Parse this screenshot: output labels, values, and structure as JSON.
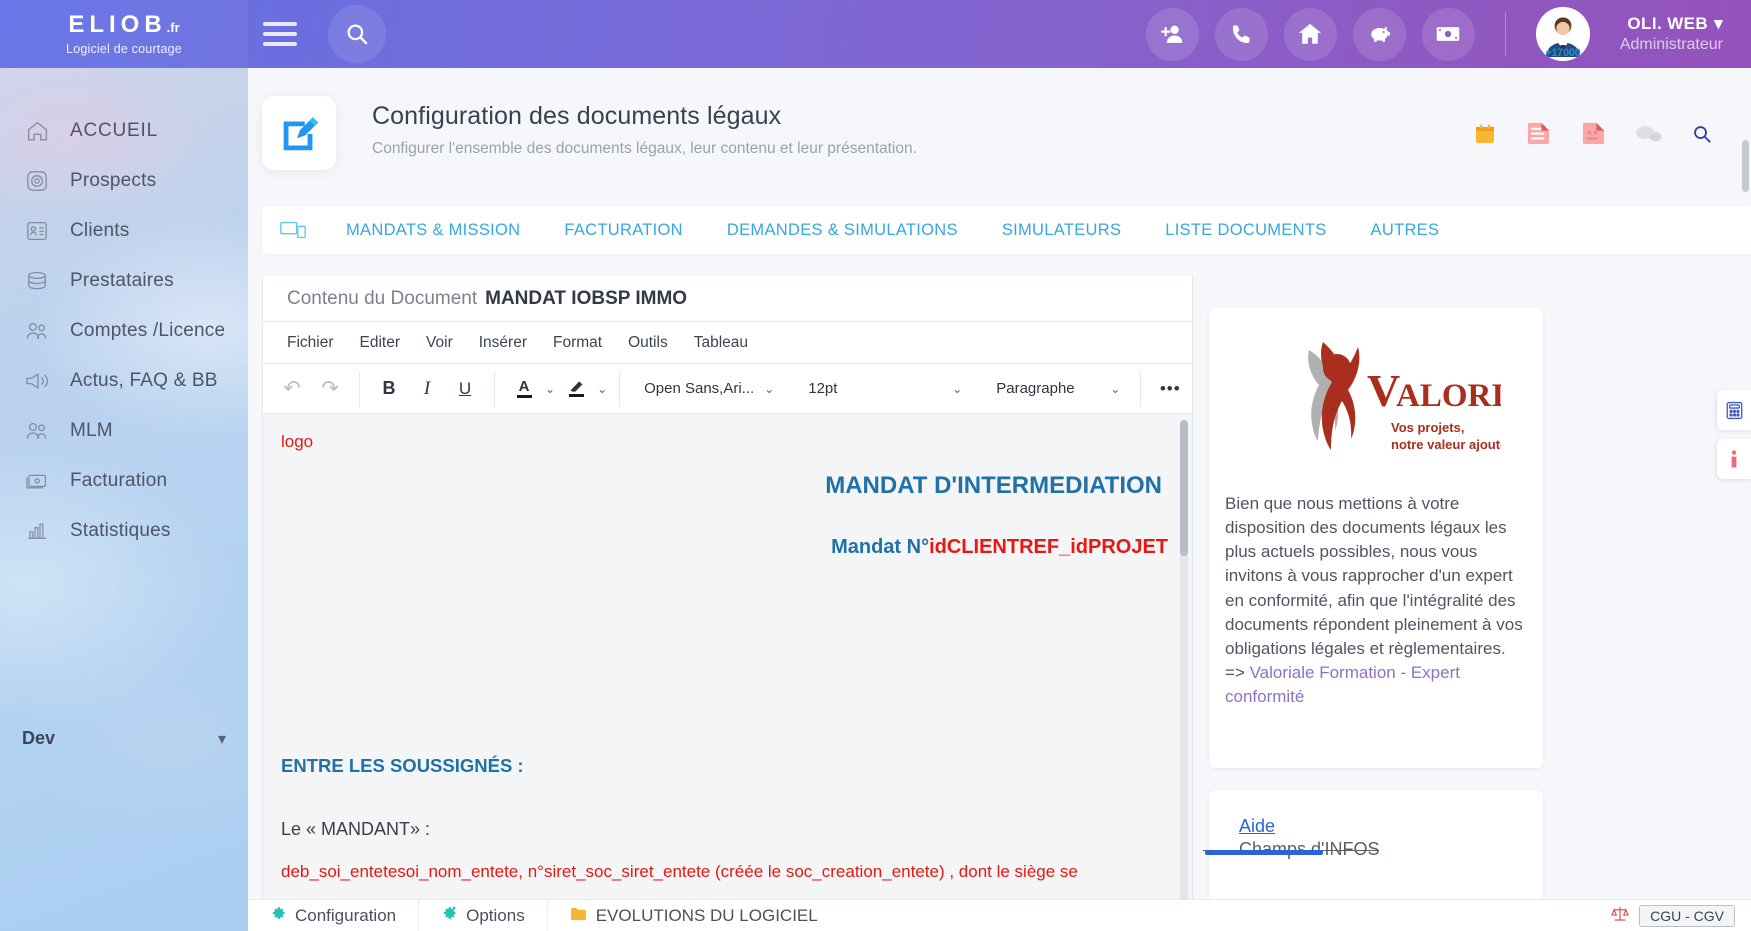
{
  "header": {
    "brand_name": "ELIOB",
    "brand_tld": ".fr",
    "brand_sub": "Logiciel de courtage",
    "icons": [
      "add-user-icon",
      "phone-icon",
      "home-icon",
      "piggy-bank-icon",
      "banknote-icon"
    ],
    "avatar_badge": "+17000",
    "user_name": "OLI. WEB",
    "user_role": "Administrateur",
    "search_icon": "search-icon",
    "menu_icon": "hamburger-menu-icon",
    "caret": "⌄"
  },
  "sidebar": {
    "items": [
      {
        "label": "ACCUEIL",
        "icon": "home-icon"
      },
      {
        "label": "Prospects",
        "icon": "target-icon"
      },
      {
        "label": "Clients",
        "icon": "id-card-icon"
      },
      {
        "label": "Prestataires",
        "icon": "database-icon"
      },
      {
        "label": "Comptes /Licence",
        "icon": "users-icon"
      },
      {
        "label": "Actus, FAQ & BB",
        "icon": "megaphone-icon"
      },
      {
        "label": "MLM",
        "icon": "users-icon"
      },
      {
        "label": "Facturation",
        "icon": "invoice-icon"
      },
      {
        "label": "Statistiques",
        "icon": "bar-chart-icon"
      }
    ],
    "dev_label": "Dev",
    "dev_caret": "⌄"
  },
  "page": {
    "title": "Configuration des documents légaux",
    "subtitle": "Configurer l'ensemble des documents légaux, leur contenu et leur présentation.",
    "icon": "edit-document-icon",
    "head_icons": [
      "calendar-icon",
      "tasks-icon",
      "notes-icon",
      "chat-bubble-icon",
      "search-icon"
    ]
  },
  "tabs": {
    "leading_icon": "devices-icon",
    "items": [
      "MANDATS & MISSION",
      "FACTURATION",
      "DEMANDES & SIMULATIONS",
      "SIMULATEURS",
      "LISTE DOCUMENTS",
      "AUTRES"
    ]
  },
  "editor": {
    "panel_label": "Contenu du Document",
    "document_name": "MANDAT IOBSP IMMO",
    "menus": [
      "Fichier",
      "Editer",
      "Voir",
      "Insérer",
      "Format",
      "Outils",
      "Tableau"
    ],
    "toolbar": {
      "undo": "↶",
      "redo": "↷",
      "bold": "B",
      "italic": "I",
      "underline": "U",
      "text_color": "A",
      "highlight": "✎",
      "font_family": "Open Sans,Ari...",
      "font_size": "12pt",
      "block_format": "Paragraphe",
      "more": "•••",
      "chevron": "⌄"
    },
    "content": {
      "logo_placeholder": "logo",
      "heading_main": "MANDAT D'INTERMEDIATION",
      "mandat_label": "Mandat N°",
      "mandat_value": "idCLIENTREF_idPROJET",
      "section_title": "ENTRE LES SOUSSIGNÉS :",
      "party_label": "Le « MANDANT» :",
      "party_fields": "deb_soi_entetesoi_nom_entete, n°siret_soc_siret_entete (créée le  soc_creation_entete) , dont le siège se"
    }
  },
  "right_panel": {
    "logo_name": "VALORIALE",
    "logo_initial": "V",
    "logo_rest": "ALORIALE",
    "logo_tagline_1": "Vos projets,",
    "logo_tagline_2": "notre valeur ajoutée.",
    "body_text": "Bien que nous mettions à votre disposition des documents légaux les plus actuels possibles, nous vous invitons à vous rapprocher d'un expert en conformité, afin que l'intégralité des documents répondent pleinement à vos obligations légales et règlementaires.",
    "link_prefix": "=> ",
    "link_text": "Valoriale Formation - Expert conformité",
    "aide_label": "Aide",
    "champs_label": "Champs d'INFOS"
  },
  "rail": {
    "buttons": [
      {
        "icon": "calculator-icon"
      },
      {
        "icon": "info-icon"
      }
    ]
  },
  "bottom_bar": {
    "items": [
      {
        "label": "Configuration",
        "icon": "gear-icon"
      },
      {
        "label": "Options",
        "icon": "gear-options-icon"
      }
    ],
    "evolutions_label": "EVOLUTIONS DU LOGICIEL",
    "folder_icon": "folder-icon",
    "scales_icon": "scales-icon",
    "chip_label": "CGU - CGV"
  },
  "colors": {
    "header_start": "#6370e8",
    "header_end": "#9452bc",
    "tab_blue": "#35a8e0",
    "doc_blue": "#2171a8",
    "doc_red": "#e8170f",
    "link_purple": "#8d72c6",
    "aide_blue": "#2b63d9"
  }
}
